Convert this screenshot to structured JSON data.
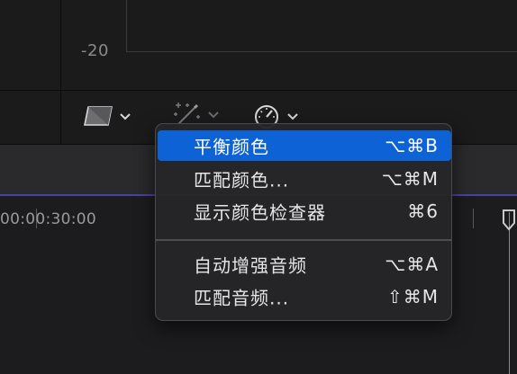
{
  "scope": {
    "value_label": "-20"
  },
  "toolbar": {
    "tools": [
      {
        "icon": "color-board-icon"
      },
      {
        "icon": "magic-wand-icon"
      },
      {
        "icon": "speedometer-icon"
      }
    ],
    "chevron": "⌄"
  },
  "timeline": {
    "timecode": "00:00:30:00"
  },
  "menu": {
    "items": [
      {
        "label": "平衡颜色",
        "shortcut": "⌥⌘B",
        "selected": true
      },
      {
        "label": "匹配颜色...",
        "shortcut": "⌥⌘M",
        "selected": false
      },
      {
        "label": "显示颜色检查器",
        "shortcut": "⌘6",
        "selected": false
      },
      {
        "label": "自动增强音频",
        "shortcut": "⌥⌘A",
        "selected": false
      },
      {
        "label": "匹配音频...",
        "shortcut": "⇧⌘M",
        "selected": false
      }
    ]
  },
  "colors": {
    "selection": "#0d62d6",
    "timeline_accent": "#4b42a6",
    "menu_background": "#262628"
  }
}
